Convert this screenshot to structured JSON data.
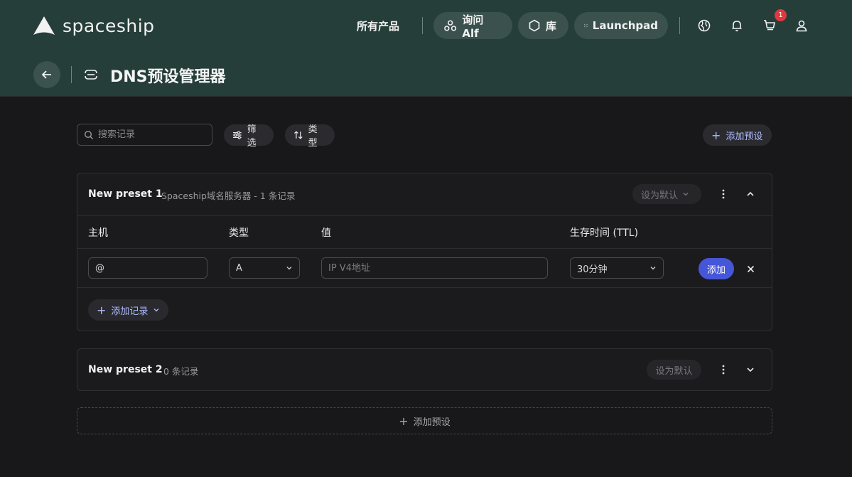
{
  "header": {
    "brand": "spaceship",
    "nav_products": "所有产品",
    "pills": {
      "ask_alf": "询问 Alf",
      "library": "库",
      "launchpad": "Launchpad"
    },
    "cart_count": "1"
  },
  "page": {
    "title": "DNS预设管理器"
  },
  "toolbar": {
    "search_placeholder": "搜索记录",
    "filter_label": "筛选",
    "type_label": "类型",
    "add_preset_label": "添加预设"
  },
  "preset1": {
    "name": "New preset 1",
    "subtitle": "Spaceship域名服务器 - 1 条记录",
    "set_default": "设为默认",
    "columns": [
      "主机",
      "类型",
      "值",
      "生存时间 (TTL)"
    ],
    "row": {
      "host_value": "@",
      "type_value": "A",
      "value_placeholder": "IP V4地址",
      "ttl_value": "30分钟",
      "add_label": "添加"
    },
    "add_record_label": "添加记录"
  },
  "preset2": {
    "name": "New preset 2",
    "subtitle": "0 条记录",
    "set_default": "设为默认"
  },
  "bottom": {
    "add_preset_label": "添加预设"
  },
  "colors": {
    "header_bg": "#253e3a",
    "body_bg": "#18181a",
    "accent": "#4656d8",
    "badge": "#e0383e"
  }
}
